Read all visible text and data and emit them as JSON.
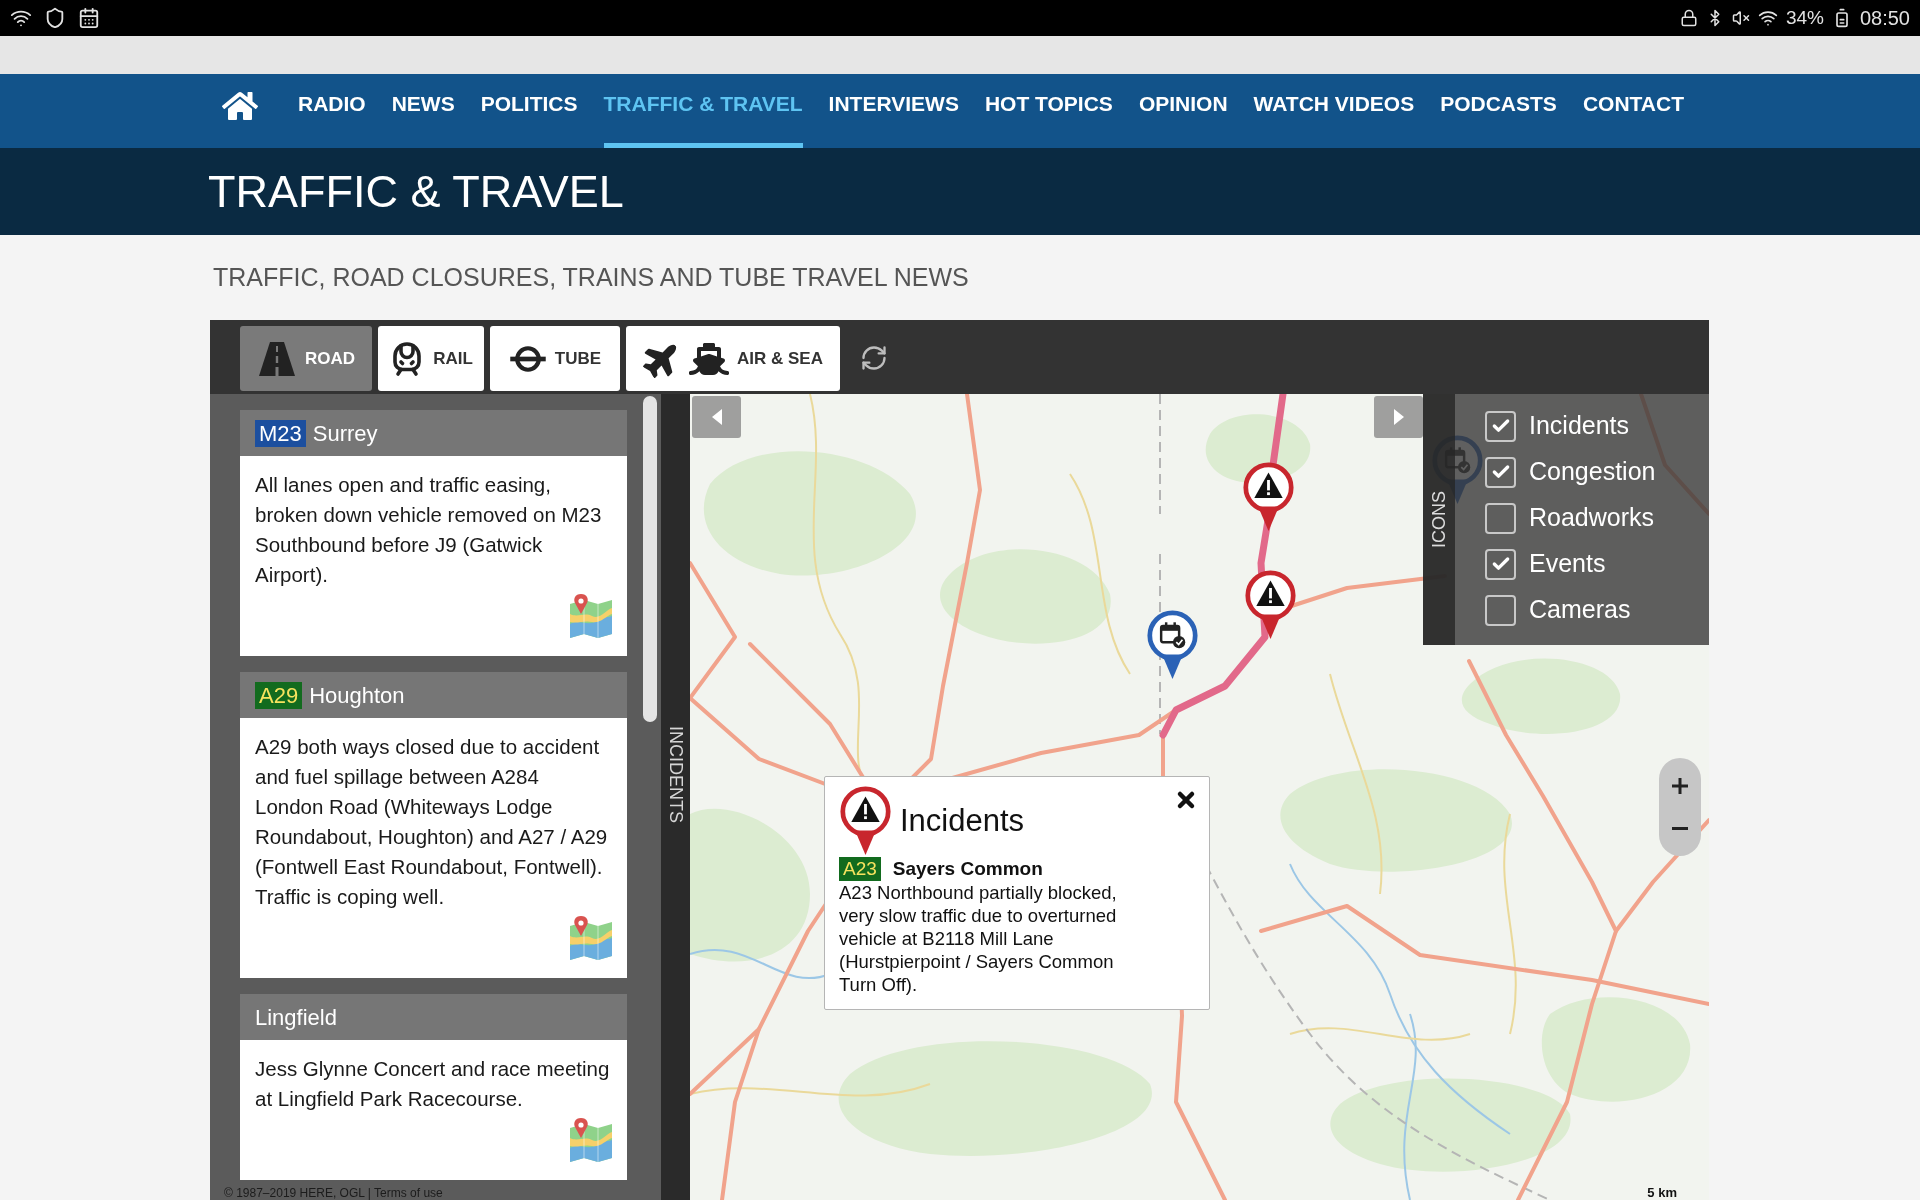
{
  "status_bar": {
    "battery": "34%",
    "time": "08:50"
  },
  "nav": {
    "items": [
      {
        "label": "RADIO",
        "selected": false
      },
      {
        "label": "NEWS",
        "selected": false
      },
      {
        "label": "POLITICS",
        "selected": false
      },
      {
        "label": "TRAFFIC & TRAVEL",
        "selected": true
      },
      {
        "label": "INTERVIEWS",
        "selected": false
      },
      {
        "label": "HOT TOPICS",
        "selected": false
      },
      {
        "label": "OPINION",
        "selected": false
      },
      {
        "label": "WATCH VIDEOS",
        "selected": false
      },
      {
        "label": "PODCASTS",
        "selected": false
      },
      {
        "label": "CONTACT",
        "selected": false
      }
    ]
  },
  "page_title": "TRAFFIC & TRAVEL",
  "subtitle": "TRAFFIC, ROAD CLOSURES, TRAINS AND TUBE TRAVEL NEWS",
  "mode_tabs": [
    {
      "kind": "road",
      "label": "ROAD",
      "selected": true
    },
    {
      "kind": "rail",
      "label": "RAIL",
      "selected": false
    },
    {
      "kind": "tube",
      "label": "TUBE",
      "selected": false
    },
    {
      "kind": "air_sea",
      "label": "AIR & SEA",
      "selected": false
    }
  ],
  "incidents_panel": {
    "tab_label": "INCIDENTS",
    "cards": [
      {
        "road": {
          "kind": "motorway",
          "label": "M23"
        },
        "title": "Surrey",
        "description": "All lanes open and traffic easing, broken down vehicle removed on M23 Southbound before J9 (Gatwick Airport)."
      },
      {
        "road": {
          "kind": "a_road",
          "label": "A29"
        },
        "title": "Houghton",
        "description": "A29 both ways closed due to accident and fuel spillage between A284 London Road (Whiteways Lodge Roundabout, Houghton) and A27 / A29 (Fontwell East Roundabout, Fontwell). Traffic is coping well."
      },
      {
        "title": "Lingfield",
        "description": "Jess Glynne Concert and race meeting at Lingfield Park Racecourse."
      }
    ]
  },
  "map": {
    "popup": {
      "title": "Incidents",
      "road": {
        "kind": "a_road",
        "label": "A23"
      },
      "location": "Sayers Common",
      "description": "A23 Northbound partially blocked, very slow traffic due to overturned vehicle at B2118 Mill Lane (Hurstpierpoint / Sayers Common Turn Off)."
    },
    "layers": {
      "tab_label": "ICONS",
      "items": [
        {
          "label": "Incidents",
          "checked": true
        },
        {
          "label": "Congestion",
          "checked": true
        },
        {
          "label": "Roadworks",
          "checked": false
        },
        {
          "label": "Events",
          "checked": true
        },
        {
          "label": "Cameras",
          "checked": false
        }
      ]
    },
    "scale": "5 km",
    "attribution": {
      "text": "© 1987–2019 HERE, OGL |",
      "link": "Terms of use"
    }
  }
}
